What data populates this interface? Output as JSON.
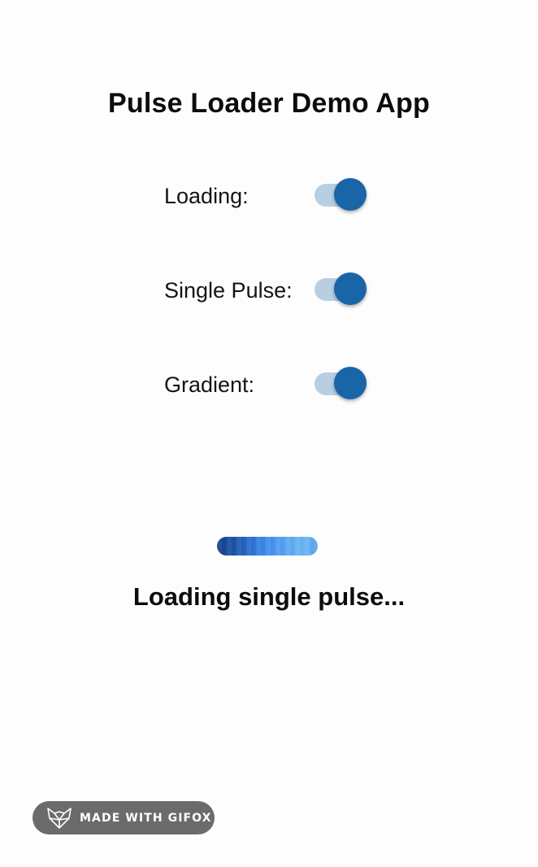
{
  "app": {
    "title": "Pulse Loader Demo App"
  },
  "settings": [
    {
      "label": "Loading:",
      "enabled": true
    },
    {
      "label": "Single Pulse:",
      "enabled": true
    },
    {
      "label": "Gradient:",
      "enabled": true
    }
  ],
  "loader": {
    "status_text": "Loading single pulse...",
    "gradient_colors": [
      "#173f8c",
      "#2a6fd0",
      "#4d98f2",
      "#6cb8f7"
    ]
  },
  "watermark": {
    "text": "MADE WITH GIFOX",
    "icon": "fox-icon"
  },
  "colors": {
    "switch_thumb_on": "#1a64a8",
    "switch_track_on": "#b8cfe3",
    "badge_bg": "#6b6b6b",
    "background": "#fdfdfd"
  }
}
